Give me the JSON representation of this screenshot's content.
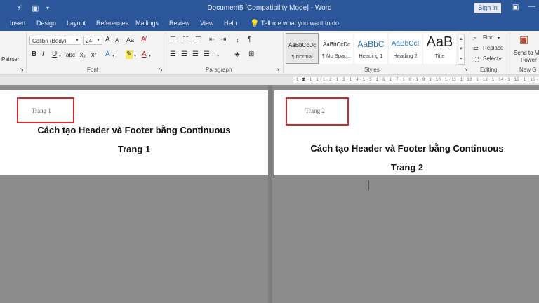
{
  "window": {
    "title": "Document5 [Compatibility Mode] - Word",
    "sign_in": "Sign in",
    "ribbon_display_icon": "ribbon-display-options-icon",
    "minimize_icon": "minimize-icon",
    "quick_access": [
      "autosave-icon",
      "save-icon",
      "qat-dropdown-icon"
    ]
  },
  "tabs": [
    "Insert",
    "Design",
    "Layout",
    "References",
    "Mailings",
    "Review",
    "View",
    "Help"
  ],
  "tell_me": "Tell me what you want to do",
  "clipboard": {
    "painter": "Painter"
  },
  "font": {
    "name": "Calibri (Body)",
    "size": "24",
    "label": "Font",
    "bold": "B",
    "italic": "I",
    "underline": "U",
    "strike": "abc",
    "subscript": "x₂",
    "superscript": "x²",
    "grow": "A",
    "shrink": "A",
    "case": "Aa"
  },
  "paragraph": {
    "label": "Paragraph"
  },
  "styles": {
    "label": "Styles",
    "items": [
      {
        "preview": "AaBbCcDc",
        "name": "¶ Normal"
      },
      {
        "preview": "AaBbCcDc",
        "name": "¶ No Spac..."
      },
      {
        "preview": "AaBbC",
        "name": "Heading 1"
      },
      {
        "preview": "AaBbCcI",
        "name": "Heading 2"
      },
      {
        "preview": "AaB",
        "name": "Title"
      }
    ]
  },
  "editing": {
    "label": "Editing",
    "find": "Find",
    "replace": "Replace",
    "select": "Select"
  },
  "send_group": {
    "line1": "Send to M",
    "line2": "Power",
    "label": "New G"
  },
  "ruler": "· 1 · 2 · 1 · 1 · 1 · 2 · 1 · 3 · 1 · 4 · 1 · 5 · 1 · 6 · 1 · 7 · 1 · 8 · 1 · 9 · 1 · 10 · 1 · 11 · 1 · 12 · 1 · 13 · 1 · 14 · 1 · 15 · 1 · 16 · 1 · 18 ·",
  "pages": [
    {
      "header": "Trang 1",
      "title": "Cách tạo Header và Footer bằng Continuous",
      "subtitle": "Trang 1"
    },
    {
      "header": "Trang 2",
      "title": "Cách tạo Header và Footer bằng Continuous",
      "subtitle": "Trang 2"
    }
  ]
}
